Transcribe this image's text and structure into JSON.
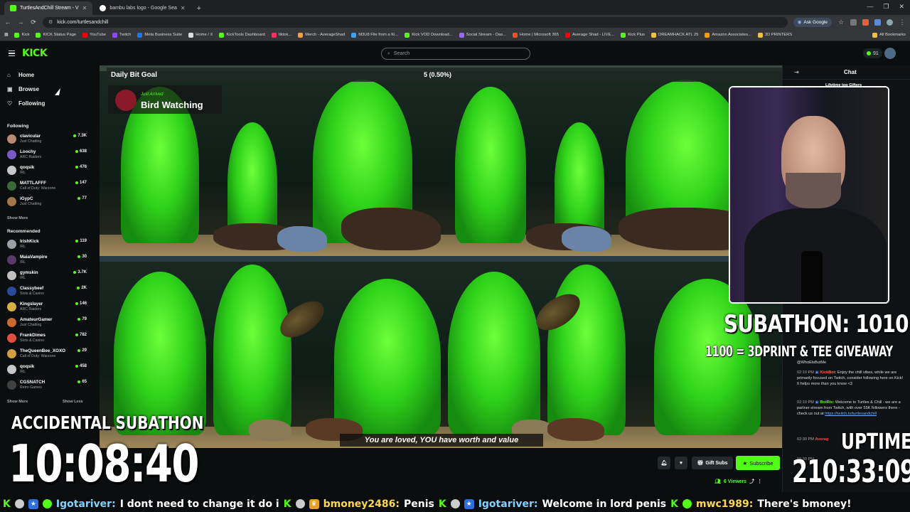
{
  "browser": {
    "tabs": [
      {
        "title": "TurtlesAndChill Stream - V",
        "active": true
      },
      {
        "title": "bambu labs logo - Google Sea",
        "active": false
      }
    ],
    "url": "kick.com/turtlesandchill",
    "ask_google": "Ask Google",
    "bookmarks": [
      "Kick",
      "KICK Status Page",
      "YouTube",
      "Twitch",
      "Meta Business Suite",
      "Home / X",
      "KickTools Dashboard",
      "tiktok...",
      "Merch - AverageShad",
      "M3U8 File from a Ki...",
      "Kick VOD Download...",
      "Social Stream - Das...",
      "Home | Microsoft 365",
      "Average Shad - LIVE...",
      "Kick Plus",
      "DREAMHACK ATL 25",
      "Amazon Associates...",
      "3D PRINTERS"
    ],
    "all_bookmarks": "All Bookmarks"
  },
  "header": {
    "logo": "KICK",
    "search_placeholder": "Search",
    "points": "91"
  },
  "sidebar": {
    "nav": [
      {
        "label": "Home",
        "icon": "home-icon"
      },
      {
        "label": "Browse",
        "icon": "browse-icon"
      },
      {
        "label": "Following",
        "icon": "heart-icon"
      }
    ],
    "following_title": "Following",
    "following": [
      {
        "name": "clavicular",
        "category": "Just Chatting",
        "viewers": "7.3K",
        "color": "#b88a70"
      },
      {
        "name": "Loochy",
        "category": "ARC Raiders",
        "viewers": "638",
        "color": "#7a5ac8"
      },
      {
        "name": "qoqsik",
        "category": "IRL",
        "viewers": "476",
        "color": "#c8c8c8"
      },
      {
        "name": "MATTLAFFF",
        "category": "Call of Duty: Warzone",
        "viewers": "147",
        "color": "#3a6a3a"
      },
      {
        "name": "iGypC",
        "category": "Just Chatting",
        "viewers": "77",
        "color": "#a0784a"
      }
    ],
    "show_more": "Show More",
    "recommended_title": "Recommended",
    "recommended": [
      {
        "name": "IrishKick",
        "category": "IRL",
        "viewers": "119",
        "color": "#9aa0a6"
      },
      {
        "name": "MaiaVampire",
        "category": "IRL",
        "viewers": "30",
        "color": "#5a3a6a"
      },
      {
        "name": "gymskin",
        "category": "IRL",
        "viewers": "3.7K",
        "color": "#c0c0c0"
      },
      {
        "name": "Classybeef",
        "category": "Slots & Casino",
        "viewers": "2K",
        "color": "#2a4a9a"
      },
      {
        "name": "Kingslayer",
        "category": "ARC Raiders",
        "viewers": "146",
        "color": "#d8b040"
      },
      {
        "name": "AmateurGamer",
        "category": "Just Chatting",
        "viewers": "79",
        "color": "#c86a30"
      },
      {
        "name": "FrankDimes",
        "category": "Slots & Casino",
        "viewers": "782",
        "color": "#e05040"
      },
      {
        "name": "TheQueenBee_XOXO",
        "category": "Call of Duty: Warzone",
        "viewers": "29",
        "color": "#d0a040"
      },
      {
        "name": "qoqsik",
        "category": "IRL",
        "viewers": "458",
        "color": "#c8c8c8"
      },
      {
        "name": "CGSNATCH",
        "category": "Retro Games",
        "viewers": "65",
        "color": "#404040"
      }
    ],
    "show_more_2": "Show More",
    "show_less": "Show Less"
  },
  "video": {
    "goal_label": "Daily Bit Goal",
    "goal_value": "5 (0.50%)",
    "scene_small": "Just Arrived",
    "scene_title": "Bird Watching",
    "caption": "You are loved, YOU have worth and value"
  },
  "overlays": {
    "subathon": "SUBATHON: 1010",
    "giveaway": "1100 = 3DPRINT & TEE GIVEAWAY",
    "accidental": "ACCIDENTAL SUBATHON",
    "timer": "10:08:40",
    "uptime_label": "UPTIME",
    "uptime_value": "210:33:09"
  },
  "chat": {
    "title": "Chat",
    "top_text": "Lifetime top Gifters",
    "first_user": "@WhoElsButMe",
    "messages": [
      {
        "ts": "02:10 PM",
        "user": "KickBot:",
        "text": "Enjoy the chill vibes, while we are primarily focused on Twitch, consider following here on Kick! It helps more than you know <3"
      },
      {
        "ts": "02:10 PM",
        "user": "BotRix:",
        "text": "Welcome to Turtles & Chill - we are a partner stream from Twitch, with over 55K followers there - check us out at",
        "link": "https://twitch.tv/turtlesandchill"
      },
      {
        "ts": "02:30 PM",
        "user": "Averag",
        "text": ""
      },
      {
        "ts": "02:30 PM",
        "user": "",
        "text": ""
      }
    ]
  },
  "controls": {
    "gift_subs": "Gift Subs",
    "subscribe": "Subscribe",
    "viewers": "6 Viewers"
  },
  "ticker": [
    {
      "user": "Igotariver:",
      "msg": "I dont need to change it do i",
      "color": "#7fd4ff"
    },
    {
      "user": "bmoney2486:",
      "msg": "Penis",
      "color": "#ffd84d"
    },
    {
      "user": "Igotariver:",
      "msg": "Welcome in lord penis",
      "color": "#7fd4ff"
    },
    {
      "user": "mwc1989:",
      "msg": "There's bmoney!",
      "color": "#ffd84d"
    }
  ],
  "colors": {
    "accent": "#53fc18",
    "bg": "#0b0e0f"
  }
}
